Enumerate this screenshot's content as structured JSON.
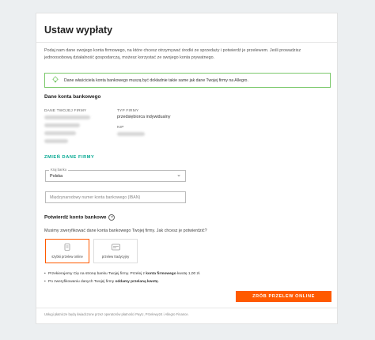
{
  "title": "Ustaw wypłaty",
  "intro": "Podaj nam dane swojego konta firmowego, na które chcesz otrzymywać środki ze sprzedaży i potwierdź je przelewem. Jeśli prowadzisz jednoosobową działalność gospodarczą, możesz korzystać ze swojego konta prywatnego.",
  "info_banner": {
    "icon": "lightbulb-icon",
    "text": "Dane właściciela konta bankowego muszą być dokładnie takie same jak dane Twojej firmy na Allegro.",
    "border_color": "#7bc96b"
  },
  "bank_details": {
    "heading": "Dane konta bankowego",
    "company_label": "DANE TWOJEJ FIRMY",
    "type_label": "TYP FIRMY",
    "type_value": "przedsiębiorca indywidualny",
    "nip_label": "NIP",
    "change_link": "ZMIEŃ DANE FIRMY"
  },
  "form": {
    "country_label": "Kraj banku",
    "country_value": "Polska",
    "iban_placeholder": "Międzynarodowy numer konta bankowego (IBAN)"
  },
  "confirm": {
    "heading": "Potwierdź konto bankowe",
    "question": "Musimy zweryfikować dane konta bankowego Twojej firmy. Jak chcesz je potwierdzić?",
    "options": [
      {
        "label": "szybki przelew online",
        "icon": "card-icon",
        "selected": true
      },
      {
        "label": "przelew tradycyjny",
        "icon": "transfer-icon",
        "selected": false
      }
    ],
    "bullet1_pre": "Przekierujemy Cię na stronę banku Twojej firmy. Przelej z ",
    "bullet1_bold": "konta firmowego",
    "bullet1_post": " kwotę 1,00 zł.",
    "bullet2_pre": "Po zweryfikowaniu danych Twojej firmy ",
    "bullet2_bold": "oddamy przelaną kwotę",
    "bullet2_post": "."
  },
  "submit_button": "ZRÓB PRZELEW ONLINE",
  "footer": "Usługi płatnicze będą świadczone przez operatorów płatności PayU, Przelewy24 i Allegro Finance.",
  "colors": {
    "accent": "#ff5a00",
    "link": "#00a790",
    "info_border": "#7bc96b"
  }
}
